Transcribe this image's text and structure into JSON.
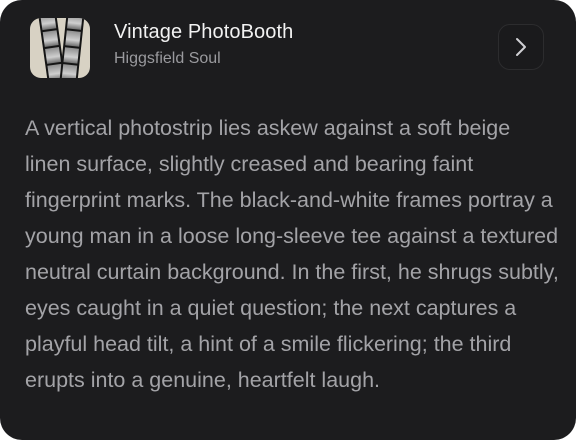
{
  "card": {
    "title": "Vintage PhotoBooth",
    "subtitle": "Higgsfield Soul",
    "thumbnail_icon": "photostrip-thumbnail",
    "action_icon": "chevron-right-icon",
    "description": "A vertical photostrip lies askew against a soft beige linen surface, slightly creased and bearing faint fingerprint marks. The black-and-white frames portray a young man in a loose long-sleeve tee against a textured neutral curtain background. In the first, he shrugs subtly, eyes caught in a quiet question; the next captures a playful head tilt, a hint of a smile flickering; the third erupts into a genuine, heartfelt laugh."
  },
  "colors": {
    "card_background": "#1c1c1e",
    "title_text": "#f2f2f2",
    "secondary_text": "#9a9a9e",
    "body_text": "#a3a3a7"
  }
}
